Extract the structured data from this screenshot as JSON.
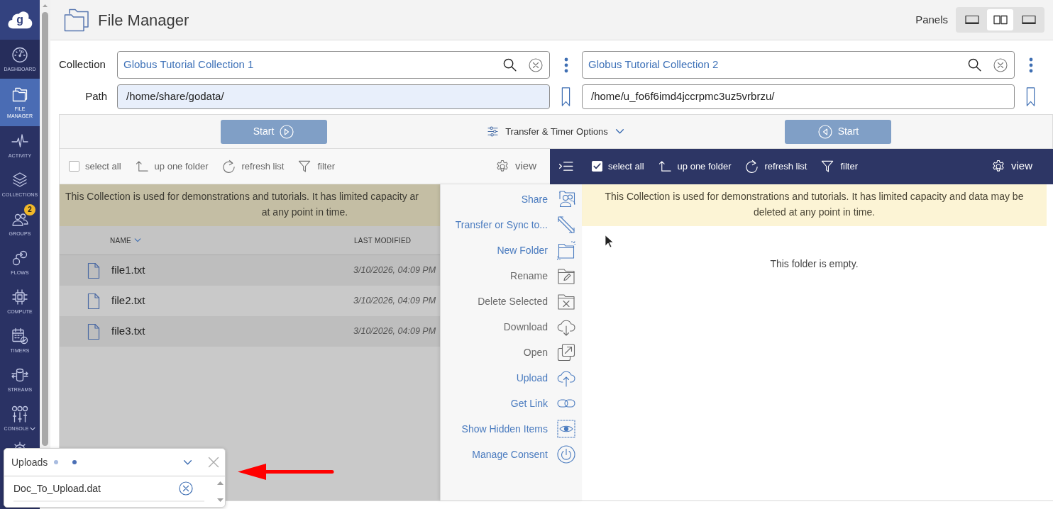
{
  "sidebar": {
    "logo": "g",
    "items": [
      {
        "kind": "dashboard",
        "label": "DASHBOARD",
        "selected": false,
        "expandable": false
      },
      {
        "kind": "file-manager",
        "label": "FILE MANAGER",
        "selected": true,
        "expandable": false
      },
      {
        "kind": "activity",
        "label": "ACTIVITY",
        "selected": false,
        "expandable": false
      },
      {
        "kind": "collections",
        "label": "COLLECTIONS",
        "selected": false,
        "expandable": false
      },
      {
        "kind": "groups",
        "label": "GROUPS",
        "selected": false,
        "expandable": false,
        "badge": "2"
      },
      {
        "kind": "flows",
        "label": "FLOWS",
        "selected": false,
        "expandable": false
      },
      {
        "kind": "compute",
        "label": "COMPUTE",
        "selected": false,
        "expandable": false
      },
      {
        "kind": "timers",
        "label": "TIMERS",
        "selected": false,
        "expandable": false
      },
      {
        "kind": "streams",
        "label": "STREAMS",
        "selected": false,
        "expandable": false
      },
      {
        "kind": "console",
        "label": "CONSOLE",
        "selected": false,
        "expandable": true
      },
      {
        "kind": "settings",
        "selected": false,
        "expandable": false
      }
    ]
  },
  "header": {
    "title": "File Manager",
    "panels_label": "Panels",
    "panel_options": [
      {
        "kind": "left",
        "selected": false
      },
      {
        "kind": "both",
        "selected": true
      },
      {
        "kind": "right",
        "selected": false
      }
    ]
  },
  "labels": {
    "collection": "Collection",
    "path": "Path"
  },
  "transfer": {
    "start_buttons": [
      {
        "label": "Start",
        "kind": "forward",
        "disabled": true
      },
      {
        "label": "Start",
        "kind": "backward",
        "disabled": true
      }
    ],
    "options": "Transfer & Timer Options"
  },
  "panes": [
    {
      "collection": "Globus Tutorial Collection 1",
      "path": "/home/share/godata/",
      "path_highlighted": true,
      "dimmed": true,
      "toolbar": {
        "active": false,
        "select_all": {
          "label": "select all",
          "checked": false
        },
        "tools": [
          {
            "kind": "up",
            "label": "up one folder"
          },
          {
            "kind": "refresh",
            "label": "refresh list"
          },
          {
            "kind": "filter",
            "label": "filter"
          }
        ],
        "view": "view"
      },
      "notice": [
        "This Collection is used for demonstrations and tutorials. It has limited capacity ar",
        "at any point in time."
      ],
      "columns": [
        {
          "label": "NAME",
          "sorted": true
        },
        {
          "label": "LAST MODIFIED",
          "sorted": false
        }
      ],
      "files": [
        {
          "name": "file1.txt",
          "modified": "3/10/2026, 04:09 PM"
        },
        {
          "name": "file2.txt",
          "modified": "3/10/2026, 04:09 PM"
        },
        {
          "name": "file3.txt",
          "modified": "3/10/2026, 04:09 PM"
        }
      ]
    },
    {
      "collection": "Globus Tutorial Collection 2",
      "path": "/home/u_fo6f6imd4jccrpmc3uz5vrbrzu/",
      "path_highlighted": false,
      "dimmed": false,
      "toolbar": {
        "active": true,
        "select_all": {
          "label": "select all",
          "checked": true
        },
        "tools": [
          {
            "kind": "up",
            "label": "up one folder"
          },
          {
            "kind": "refresh",
            "label": "refresh list"
          },
          {
            "kind": "filter",
            "label": "filter"
          }
        ],
        "view": "view"
      },
      "notice": [
        "This Collection is used for demonstrations and tutorials. It has limited capacity and data may be",
        "deleted at any point in time."
      ],
      "empty_message": "This folder is empty.",
      "action_menu": {
        "open": true,
        "items": [
          {
            "kind": "share",
            "label": "Share",
            "disabled": false
          },
          {
            "kind": "transfer",
            "label": "Transfer or Sync to...",
            "disabled": false
          },
          {
            "kind": "new-folder",
            "label": "New Folder",
            "disabled": false
          },
          {
            "kind": "rename",
            "label": "Rename",
            "disabled": true
          },
          {
            "kind": "delete",
            "label": "Delete Selected",
            "disabled": true
          },
          {
            "kind": "download",
            "label": "Download",
            "disabled": true
          },
          {
            "kind": "open",
            "label": "Open",
            "disabled": true
          },
          {
            "kind": "upload",
            "label": "Upload",
            "disabled": false
          },
          {
            "kind": "get-link",
            "label": "Get Link",
            "disabled": false
          },
          {
            "kind": "show-hidden",
            "label": "Show Hidden Items",
            "disabled": false
          },
          {
            "kind": "manage-consent",
            "label": "Manage Consent",
            "disabled": false
          }
        ]
      }
    }
  ],
  "uploads": {
    "title": "Uploads",
    "files": [
      {
        "name": "Doc_To_Upload.dat"
      }
    ]
  }
}
